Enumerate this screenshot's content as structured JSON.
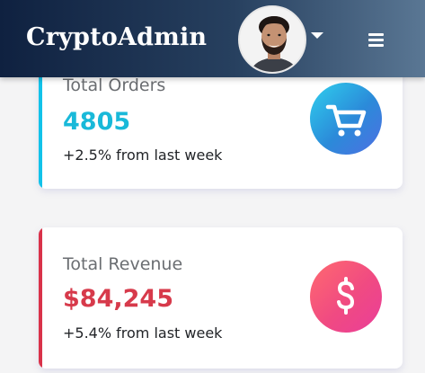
{
  "header": {
    "brand": "CryptoAdmin",
    "avatar_icon": "user-avatar",
    "dropdown_icon": "caret-down-icon",
    "menu_icon": "hamburger-menu-icon"
  },
  "cards": [
    {
      "title": "Total Orders",
      "value": "4805",
      "change": "+2.5% from last week",
      "icon": "shopping-cart-icon",
      "accent_color": "#12c2e9"
    },
    {
      "title": "Total Revenue",
      "value": "$84,245",
      "change": "+5.4% from last week",
      "icon": "dollar-sign-icon",
      "accent_color": "#d9324a"
    }
  ]
}
